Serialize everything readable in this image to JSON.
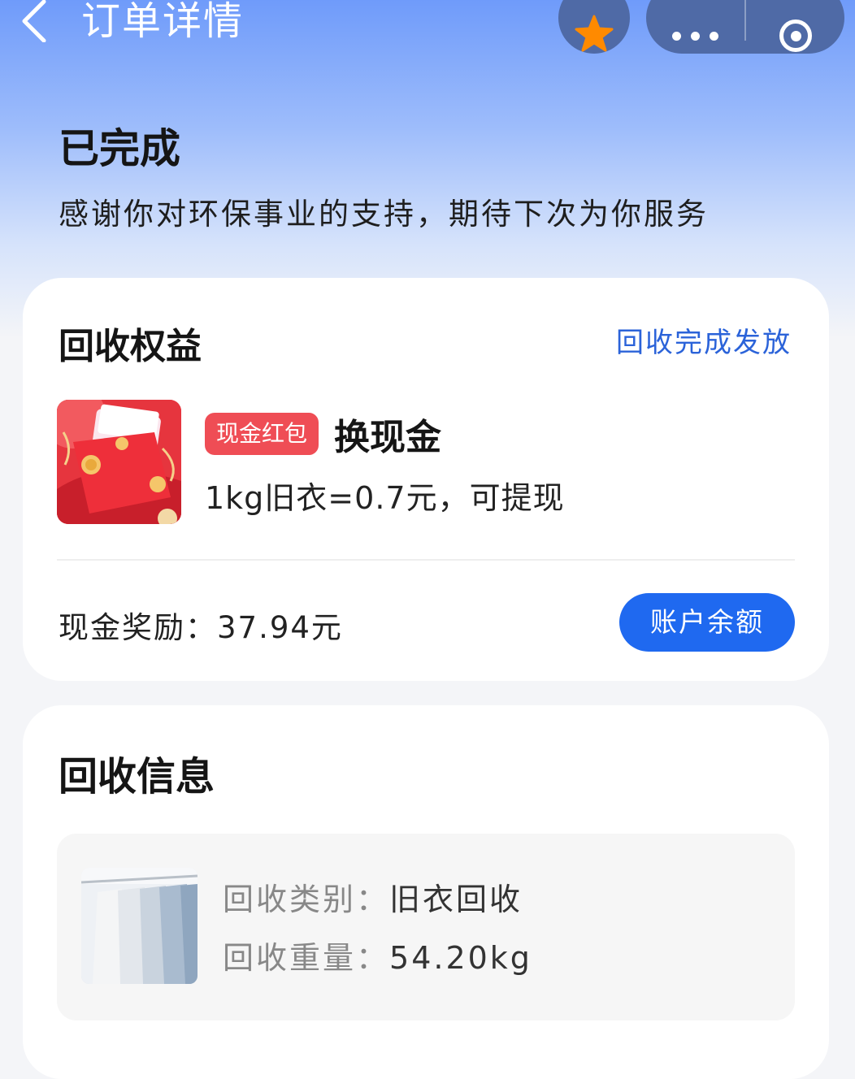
{
  "nav": {
    "title": "订单详情"
  },
  "status": {
    "title": "已完成",
    "description": "感谢你对环保事业的支持，期待下次为你服务"
  },
  "rights_card": {
    "heading": "回收权益",
    "issued_status": "回收完成发放",
    "tag": "现金红包",
    "benefit_title": "换现金",
    "benefit_desc": "1kg旧衣=0.7元，可提现",
    "reward_label": "现金奖励：37.94元",
    "balance_button": "账户余额"
  },
  "info_card": {
    "heading": "回收信息",
    "category_label": "回收类别：",
    "category_value": "旧衣回收",
    "weight_label": "回收重量：",
    "weight_value": "54.20kg"
  },
  "colors": {
    "accent_blue": "#1f69f0",
    "link_blue": "#2b63d9",
    "tag_red": "#ef4d55",
    "star_orange": "#ff8a00"
  }
}
